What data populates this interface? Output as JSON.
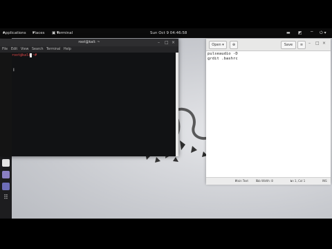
{
  "top_panel": {
    "applications": "Applications",
    "places": "Places",
    "terminal": "Terminal",
    "clock": "Sun Oct 9 04:46:58"
  },
  "terminal": {
    "title": "root@kali: ~",
    "menu": [
      "File",
      "Edit",
      "View",
      "Search",
      "Terminal",
      "Help"
    ],
    "prompt": "root@kali:~#"
  },
  "gedit": {
    "open_label": "Open",
    "save_label": "Save",
    "lines": [
      "pulseaudio -D",
      "grdit .bashrc"
    ],
    "status": {
      "language": "Plain Text",
      "tab_width": "Tab Width: 8",
      "position": "Ln 1, Col 1",
      "mode": "INS"
    }
  },
  "colors": {
    "panel": "#0b0b0b",
    "dock": "#1d1d1f",
    "terminal_bg": "#111214",
    "prompt": "#e04848"
  },
  "icons": [
    "kali-menu-icon",
    "files-icon",
    "terminal-icon",
    "metasploit-icon",
    "armitage-icon",
    "burp-icon",
    "maltego-icon",
    "beef-icon",
    "faraday-icon",
    "leafpad-icon",
    "app-grid-icon"
  ]
}
